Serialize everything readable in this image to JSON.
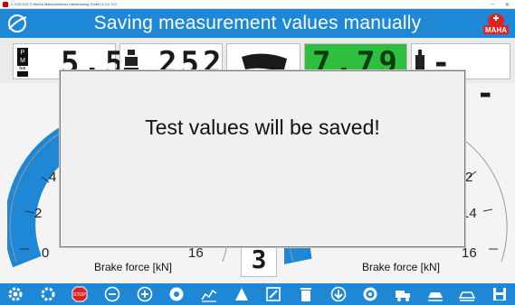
{
  "window": {
    "title": "V 3.00.023  © MAHA Maschinenbau Haldenwang GmbH & Co. KG",
    "minimize": "–",
    "close": "✕"
  },
  "header": {
    "title": "Saving measurement values manually",
    "brand": "MAHA",
    "logo_icon": "maha-swirl-icon"
  },
  "displays": {
    "pressure": {
      "label_top": "P",
      "label_mid": "M",
      "unit": "bar",
      "value": "5.5"
    },
    "weight": {
      "value": "252"
    },
    "ovality": {
      "value": "7.79"
    },
    "right": {
      "value": "--.-"
    }
  },
  "gauges": {
    "left": {
      "label": "Brake force [kN]",
      "ticks": [
        "0",
        "2",
        "4",
        "16"
      ]
    },
    "right": {
      "label": "Brake force [kN]",
      "ticks": [
        "2",
        "14",
        "16"
      ]
    }
  },
  "center_counter": "3",
  "modal": {
    "message": "Test values will be saved!"
  },
  "toolbar": {
    "buttons": [
      {
        "name": "settings-icon"
      },
      {
        "name": "settings-alt-icon"
      },
      {
        "name": "stop-icon",
        "label": "STOP"
      },
      {
        "name": "minus-circle-icon"
      },
      {
        "name": "plus-circle-icon"
      },
      {
        "name": "disc-icon"
      },
      {
        "name": "chart-icon"
      },
      {
        "name": "axle-icon"
      },
      {
        "name": "edit-icon"
      },
      {
        "name": "delete-icon"
      },
      {
        "name": "download-icon"
      },
      {
        "name": "tire-icon"
      },
      {
        "name": "truck-icon"
      },
      {
        "name": "vehicle-icon"
      },
      {
        "name": "vehicle-alt-icon"
      },
      {
        "name": "save-icon"
      }
    ]
  },
  "colors": {
    "accent": "#1e88d6",
    "ovality_bg": "#2fbf3e",
    "gauge_fill": "#1e88d6"
  }
}
